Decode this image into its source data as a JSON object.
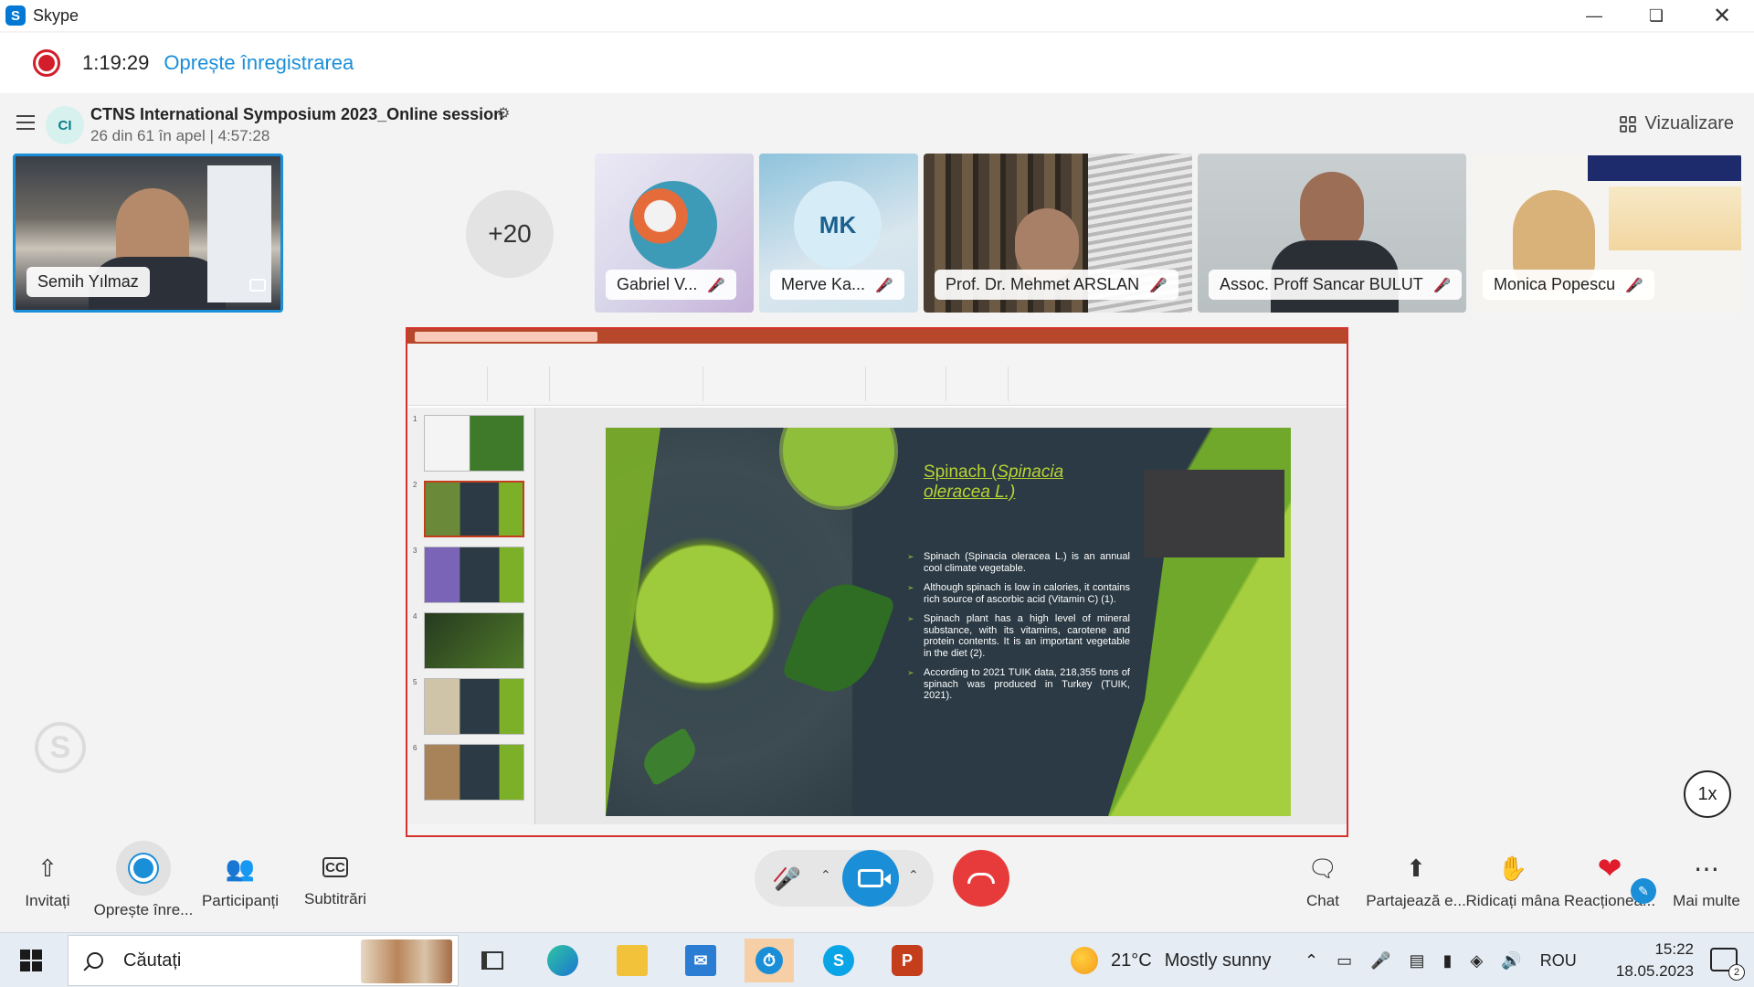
{
  "window": {
    "app_title": "Skype"
  },
  "recording": {
    "elapsed": "1:19:29",
    "stop_label": "Oprește înregistrarea"
  },
  "conversation": {
    "avatar_initials": "CI",
    "title": "CTNS International Symposium 2023_Online session",
    "subtitle": "26 din 61 în apel | 4:57:28",
    "view_label": "Vizualizare"
  },
  "participants": {
    "self_name": "Semih Yılmaz",
    "overflow_count": "+20",
    "tiles": [
      {
        "name": "Gabriel V...",
        "muted": true
      },
      {
        "name": "Merve Ka...",
        "initials": "MK",
        "muted": true
      },
      {
        "name": "Prof. Dr. Mehmet ARSLAN",
        "muted": true
      },
      {
        "name": "Assoc. Proff Sancar BULUT",
        "muted": true
      },
      {
        "name": "Monica Popescu",
        "muted": true
      }
    ]
  },
  "shared_screen": {
    "slide_title_plain": "Spinach (",
    "slide_title_italic": "Spinacia oleracea L.)",
    "bullets": [
      "Spinach (Spinacia oleracea L.) is an annual cool climate vegetable.",
      "Although spinach is low in calories, it contains rich source of ascorbic acid (Vitamin C) (1).",
      "Spinach plant has a high level of mineral substance, with its vitamins, carotene and protein contents. It is an important vegetable in the diet (2).",
      "According to 2021 TUIK data, 218,355 tons of spinach was produced in Turkey (TUIK, 2021)."
    ],
    "thumbnail_numbers": [
      "1",
      "2",
      "3",
      "4",
      "5",
      "6"
    ],
    "playback_speed": "1x"
  },
  "call_controls": {
    "invite": "Invitați",
    "stop_recording": "Oprește înre...",
    "participants": "Participanți",
    "subtitles": "Subtitrări",
    "chat": "Chat",
    "share": "Partajează e...",
    "raise_hand": "Ridicați mâna",
    "react": "Reacționea...",
    "more": "Mai multe"
  },
  "taskbar": {
    "search_placeholder": "Căutați",
    "temperature": "21°C",
    "weather": "Mostly sunny",
    "language": "ROU",
    "time": "15:22",
    "date": "18.05.2023",
    "notification_count": "2"
  }
}
